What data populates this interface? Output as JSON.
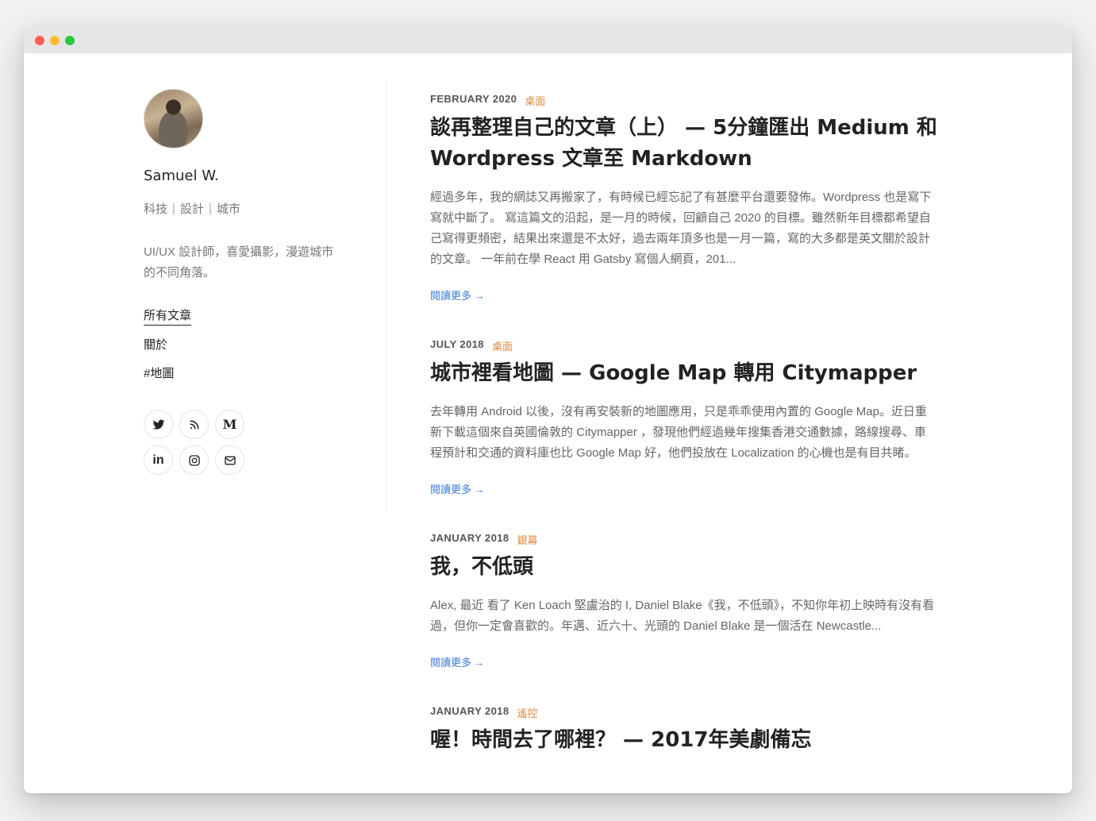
{
  "window": {
    "controls": [
      "close",
      "minimize",
      "zoom"
    ]
  },
  "sidebar": {
    "author_name": "Samuel W.",
    "tags": [
      "科技",
      "設計",
      "城市"
    ],
    "tag_separator": "|",
    "bio": "UI/UX 設計師，喜愛攝影，漫遊城市的不同角落。",
    "nav": [
      {
        "label": "所有文章",
        "active": true
      },
      {
        "label": "關於",
        "active": false
      },
      {
        "label": "#地圖",
        "active": false
      }
    ],
    "social": [
      {
        "name": "twitter-icon",
        "label": ""
      },
      {
        "name": "rss-icon",
        "label": ""
      },
      {
        "name": "medium-icon",
        "label": "M"
      },
      {
        "name": "linkedin-icon",
        "label": "in"
      },
      {
        "name": "instagram-icon",
        "label": ""
      },
      {
        "name": "mail-icon",
        "label": ""
      }
    ]
  },
  "posts": [
    {
      "date": "FEBRUARY 2020",
      "category": "桌面",
      "title": "談再整理自己的文章（上） — 5分鐘匯出 Medium 和 Wordpress 文章至 Markdown",
      "excerpt": "經過多年，我的網誌又再搬家了，有時候已經忘記了有甚麼平台還要發佈。Wordpress 也是寫下寫就中斷了。 寫這篇文的沿起，是一月的時候，回顧自己 2020 的目標。雖然新年目標都希望自己寫得更頻密，結果出來還是不太好，過去兩年頂多也是一月一篇，寫的大多都是英文關於設計的文章。 一年前在學 React 用 Gatsby 寫個人網頁，201...",
      "read_more": "閱讀更多 →"
    },
    {
      "date": "JULY 2018",
      "category": "桌面",
      "title": "城市裡看地圖 — Google Map 轉用 Citymapper",
      "excerpt": "去年轉用 Android 以後，沒有再安裝新的地圖應用，只是乖乖使用內置的 Google Map。近日重新下載這個來自英國倫敦的 Citymapper ，發現他們經過幾年搜集香港交通數據，路線搜尋、車程預計和交通的資料庫也比 Google Map 好，他們投放在 Localization 的心機也是有目共睹。",
      "read_more": "閱讀更多 →"
    },
    {
      "date": "JANUARY 2018",
      "category": "銀幕",
      "title": "我，不低頭",
      "excerpt": "Alex, 最近 看了 Ken Loach 堅盧治的 I, Daniel Blake《我，不低頭》，不知你年初上映時有沒有看過，但你一定會喜歡的。年邁、近六十、光頭的 Daniel Blake 是一個活在 Newcastle...",
      "read_more": "閱讀更多 →"
    },
    {
      "date": "JANUARY 2018",
      "category": "遙控",
      "title": "喔！時間去了哪裡？ — 2017年美劇備忘",
      "excerpt": "",
      "read_more": ""
    }
  ]
}
